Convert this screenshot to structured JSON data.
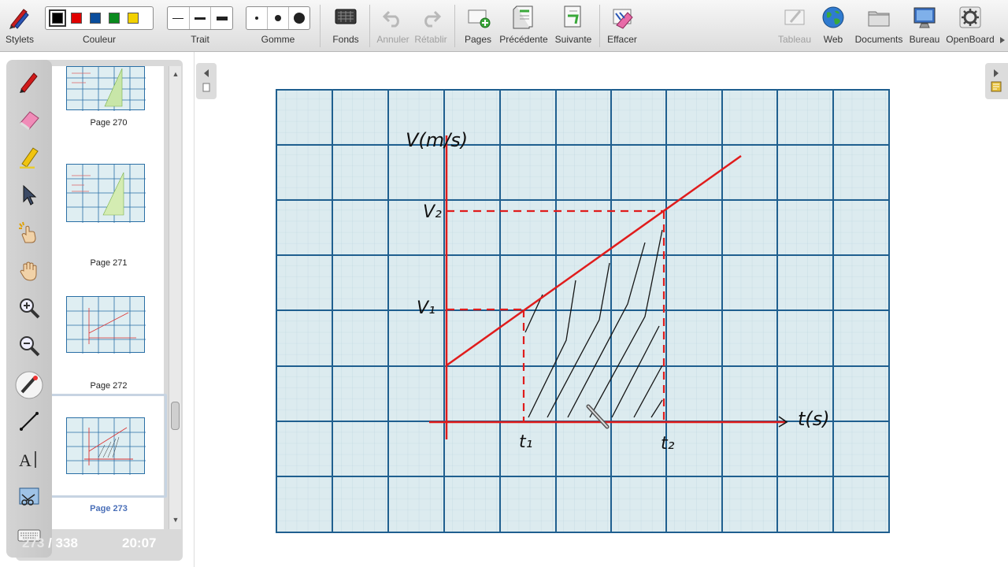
{
  "toolbar": {
    "stylets": "Stylets",
    "couleur": "Couleur",
    "trait": "Trait",
    "gomme": "Gomme",
    "fonds": "Fonds",
    "annuler": "Annuler",
    "retablir": "Rétablir",
    "pages": "Pages",
    "precedente": "Précédente",
    "suivante": "Suivante",
    "effacer": "Effacer",
    "tableau": "Tableau",
    "web": "Web",
    "documents": "Documents",
    "bureau": "Bureau",
    "openboard": "OpenBoard"
  },
  "colors": {
    "swatches": [
      "#000000",
      "#e00000",
      "#0a4d9c",
      "#0a8a1e",
      "#f2d100"
    ],
    "selected": "#000000",
    "grid_major": "#1f5f8f",
    "grid_minor": "#b9d3dd",
    "paper": "#dcebef",
    "pen_red": "#e01c1c"
  },
  "tools": [
    "pen-icon",
    "eraser-icon",
    "marker-icon",
    "selector-icon",
    "interact-icon",
    "hand-icon",
    "zoom-in-icon",
    "zoom-out-icon",
    "laser-pointer-icon",
    "line-icon",
    "text-icon",
    "capture-icon",
    "keyboard-icon"
  ],
  "pages": [
    {
      "label": "Page 270"
    },
    {
      "label": "Page 271"
    },
    {
      "label": "Page 272"
    },
    {
      "label": "Page 273"
    }
  ],
  "pager": {
    "current": "273",
    "sep": " / ",
    "total": "338"
  },
  "clock": "20:07",
  "board": {
    "y_axis_label": "V(m/s)",
    "x_axis_label": "t(s)",
    "v1": "V₁",
    "v2": "V₂",
    "t1": "t₁",
    "t2": "t₂"
  }
}
